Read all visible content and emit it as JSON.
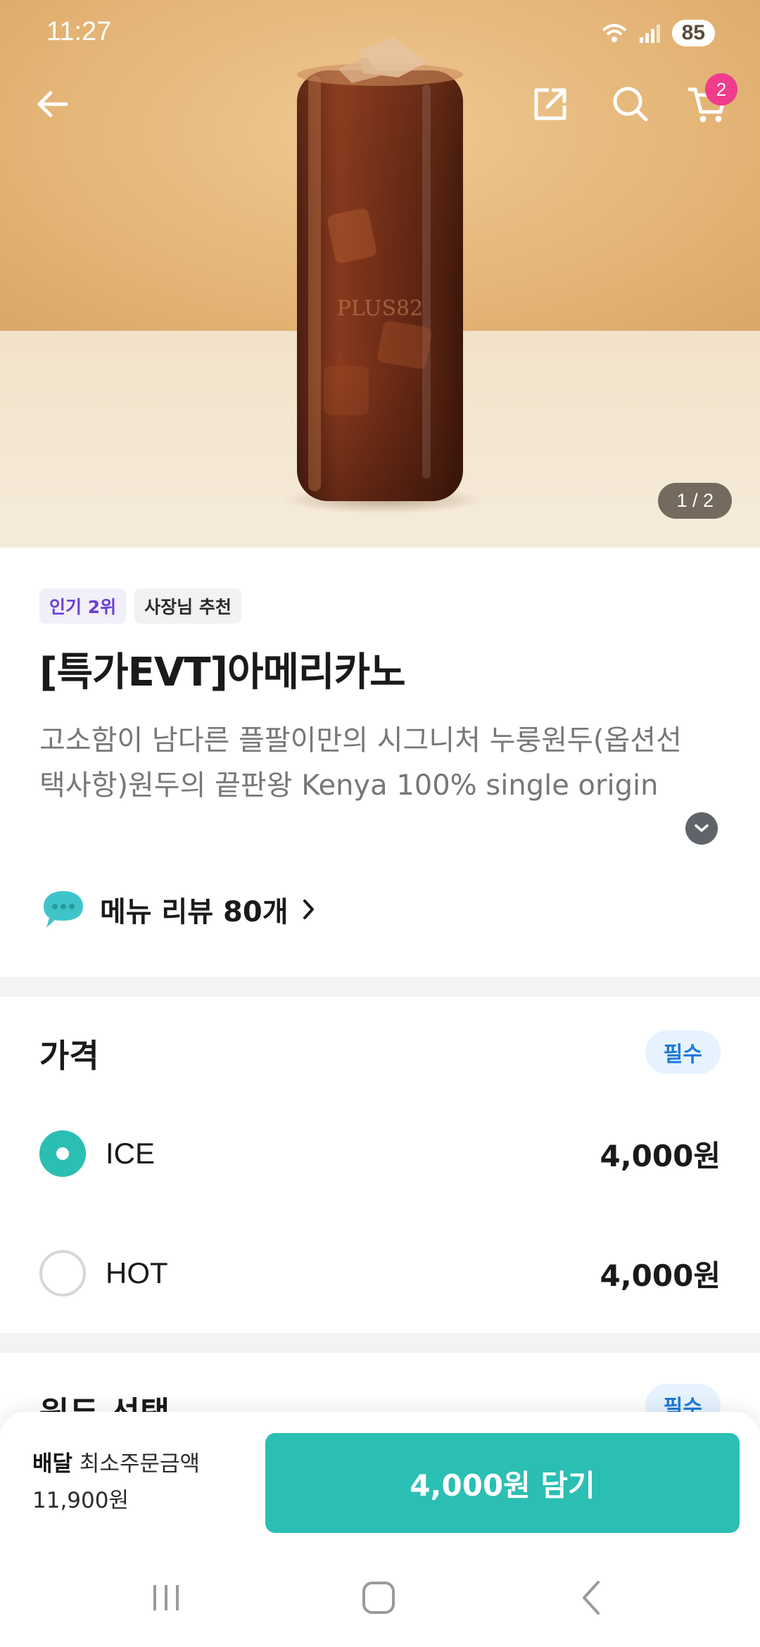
{
  "status_bar": {
    "time": "11:27",
    "battery": "85"
  },
  "hero": {
    "page_indicator": "1 / 2",
    "cart_count": "2",
    "glass_text": "PLUS82"
  },
  "product": {
    "badges": [
      "인기 2위",
      "사장님 추천"
    ],
    "title": "[특가EVT]아메리카노",
    "description": "고소함이 남다른 플팔이만의 시그니처 누룽원두(옵션선택사항)원두의 끝판왕 Kenya 100% single origin",
    "review_label": "메뉴 리뷰 80개"
  },
  "price_section": {
    "title": "가격",
    "required_label": "필수",
    "options": [
      {
        "label": "ICE",
        "price": "4,000원",
        "selected": true
      },
      {
        "label": "HOT",
        "price": "4,000원",
        "selected": false
      }
    ]
  },
  "bean_section": {
    "title": "원두 선택",
    "required_label": "필수"
  },
  "bottom_bar": {
    "delivery_label": "배달",
    "min_order_label": "최소주문금액",
    "min_order_value": "11,900원",
    "add_button_label": "4,000원 담기"
  },
  "colors": {
    "accent": "#2bbfb3",
    "badge_pink": "#ef3d8c",
    "required_blue": "#1f7ad8"
  },
  "icons": [
    "back-arrow-icon",
    "share-icon",
    "search-icon",
    "cart-icon",
    "chevron-down-icon",
    "chat-bubble-icon",
    "chevron-right-icon",
    "recent-apps-icon",
    "home-icon",
    "back-icon"
  ]
}
